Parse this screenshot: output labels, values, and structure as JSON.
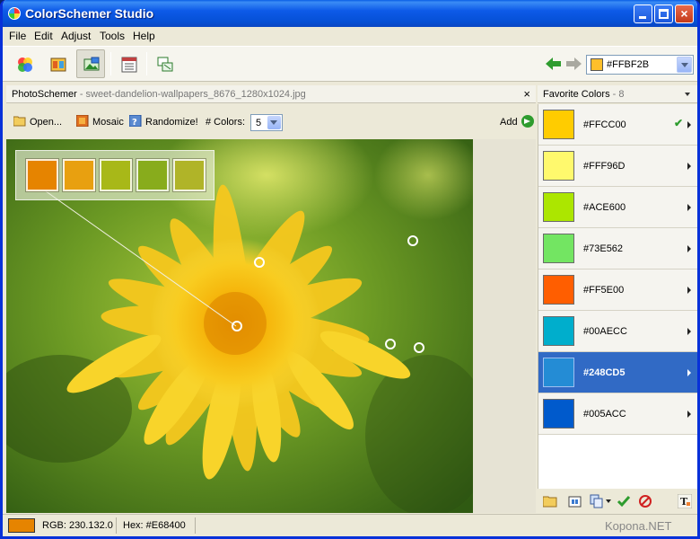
{
  "window": {
    "title": "ColorSchemer Studio"
  },
  "menu": [
    "File",
    "Edit",
    "Adjust",
    "Tools",
    "Help"
  ],
  "toolbar": {
    "tools": [
      {
        "name": "color-wheel-tool",
        "icon": "color-wheel-icon"
      },
      {
        "name": "scheme-tool",
        "icon": "scheme-icon"
      },
      {
        "name": "photoschemer-tool",
        "icon": "photo-icon",
        "active": true
      },
      {
        "name": "gallery-tool",
        "icon": "gallery-icon"
      },
      {
        "name": "quickpreview-tool",
        "icon": "preview-icon"
      }
    ],
    "current_color": {
      "hex": "#FFBF2B",
      "color": "#FFBF2B"
    }
  },
  "document": {
    "panel_name": "PhotoSchemer",
    "separator": " - ",
    "file_name": "sweet-dandelion-wallpapers_8676_1280x1024.jpg",
    "close_label": "×"
  },
  "photoschemer_toolbar": {
    "open_label": "Open...",
    "mosaic_label": "Mosaic",
    "randomize_label": "Randomize!",
    "num_colors_label": "# Colors:",
    "num_colors_value": "5",
    "add_label": "Add"
  },
  "extracted_swatches": [
    "#E68400",
    "#E8A010",
    "#A8B818",
    "#88AC1C",
    "#B0B428"
  ],
  "favorites": {
    "title": "Favorite Colors",
    "separator": " - ",
    "count": "8",
    "items": [
      {
        "hex": "#FFCC00",
        "color": "#FFCC00",
        "checked": true,
        "selected": false
      },
      {
        "hex": "#FFF96D",
        "color": "#FFF96D",
        "checked": false,
        "selected": false
      },
      {
        "hex": "#ACE600",
        "color": "#ACE600",
        "checked": false,
        "selected": false
      },
      {
        "hex": "#73E562",
        "color": "#73E562",
        "checked": false,
        "selected": false
      },
      {
        "hex": "#FF5E00",
        "color": "#FF5E00",
        "checked": false,
        "selected": false
      },
      {
        "hex": "#00AECC",
        "color": "#00AECC",
        "checked": false,
        "selected": false
      },
      {
        "hex": "#248CD5",
        "color": "#248CD5",
        "checked": false,
        "selected": true
      },
      {
        "hex": "#005ACC",
        "color": "#005ACC",
        "checked": false,
        "selected": false
      }
    ]
  },
  "status": {
    "swatch_color": "#E68400",
    "rgb_text": "RGB: 230.132.0",
    "hex_text": "Hex: #E68400",
    "watermark": "Kopona.NET"
  },
  "colors": {
    "selection_blue": "#316AC5",
    "titlebar_blue": "#0A5FE6",
    "window_bg": "#ECE9D8"
  }
}
